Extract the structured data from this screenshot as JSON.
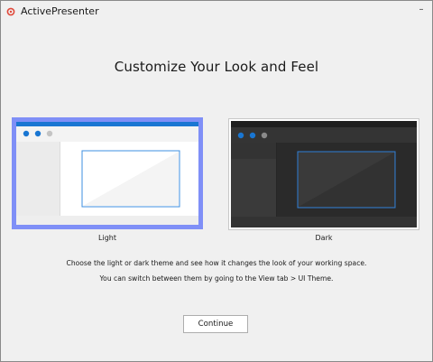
{
  "window": {
    "title": "ActivePresenter",
    "minimize_glyph": "–"
  },
  "heading": "Customize Your Look and Feel",
  "themes": [
    {
      "label": "Light",
      "selected": true
    },
    {
      "label": "Dark",
      "selected": false
    }
  ],
  "description": {
    "line1": "Choose the light or dark theme and see how it changes the look of your working space.",
    "line2": "You can switch between them by going to the View tab > UI Theme."
  },
  "continue_label": "Continue",
  "colors": {
    "accent": "#1976d2",
    "selection_border": "#7f8ff7",
    "dark_bg": "#2a2a2a",
    "app_icon": "#e0483a"
  },
  "icons": {
    "app": "app-logo-icon",
    "minimize": "minimize-icon",
    "window_dots": "window-control-dots-icon"
  }
}
